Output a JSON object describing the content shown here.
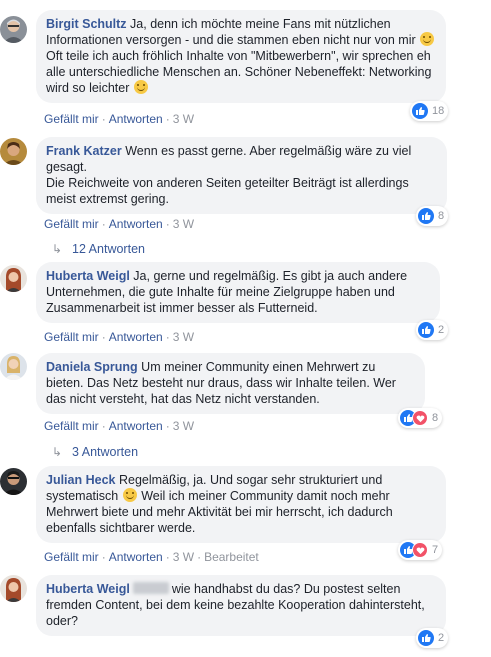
{
  "actions": {
    "like": "Gefällt mir",
    "reply": "Antworten",
    "edited": "Bearbeitet",
    "dot": "·"
  },
  "comments": [
    {
      "author": "Birgit Schultz",
      "text_1": "Ja, denn ich möchte meine Fans mit nützlichen Informationen versorgen - und die stammen eben nicht nur von mir",
      "text_2": "Oft teile ich auch fröhlich Inhalte von \"Mitbewerbern\", wir sprechen eh alle unterschiedliche Menschen an. Schöner Nebeneffekt: Networking wird so leichter",
      "time": "3 W",
      "reactions": "18"
    },
    {
      "author": "Frank Katzer",
      "text_1": "Wenn es passt gerne. Aber regelmäßig wäre zu viel gesagt.",
      "text_2": "Die Reichweite von anderen Seiten geteilter Beiträgt ist allerdings meist extremst gering.",
      "time": "3 W",
      "reactions": "8",
      "replies": "12 Antworten"
    },
    {
      "author": "Huberta Weigl",
      "text_1": "Ja, gerne und regelmäßig. Es gibt ja auch andere Unternehmen, die gute Inhalte für meine Zielgruppe haben und Zusammenarbeit ist immer besser als Futterneid.",
      "time": "3 W",
      "reactions": "2"
    },
    {
      "author": "Daniela Sprung",
      "text_1": "Um meiner Community einen Mehrwert zu bieten. Das Netz besteht nur draus, dass wir Inhalte teilen. Wer das nicht versteht, hat das Netz nicht verstanden.",
      "time": "3 W",
      "reactions": "8",
      "replies": "3 Antworten"
    },
    {
      "author": "Julian Heck",
      "text_1": "Regelmäßig, ja. Und sogar sehr strukturiert und systematisch",
      "text_2": "Weil ich meiner Community damit noch mehr Mehrwert biete und mehr Aktivität bei mir herrscht, ich dadurch ebenfalls sichtbarer werde.",
      "time": "3 W",
      "reactions": "7"
    },
    {
      "author": "Huberta Weigl",
      "text_1": "wie handhabst du das? Du postest selten fremden Content, bei dem keine bezahlte Kooperation dahintersteht, oder?",
      "time": "3 W",
      "reactions": "2"
    }
  ],
  "colors": {
    "link": "#385898",
    "bubble": "#f2f3f5",
    "meta": "#90949c",
    "like": "#2078f4",
    "love": "#f25268"
  }
}
